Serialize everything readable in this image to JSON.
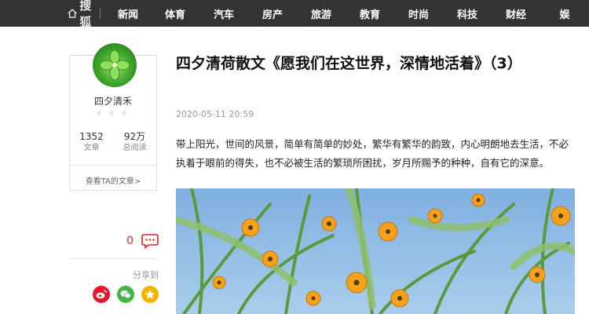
{
  "header": {
    "logo_text": "搜狐",
    "nav": [
      "新闻",
      "体育",
      "汽车",
      "房产",
      "旅游",
      "教育",
      "时尚",
      "科技",
      "财经",
      "娱"
    ]
  },
  "author": {
    "name": "四夕清禾",
    "articles_count": "1352",
    "articles_label": "文章",
    "views_count": "92万",
    "views_label": "总阅读",
    "link_text": "查看TA的文章>"
  },
  "sidebar": {
    "comment_count": "0",
    "share_label": "分享到"
  },
  "article": {
    "title": "四夕清荷散文《愿我们在这世界，深情地活着》（3）",
    "date": "2020-05-11 20:59",
    "paragraph": "带上阳光，世间的风景，简单有简单的妙处，繁华有繁华的韵致，内心明朗地去生活，不必执着于眼前的得失，也不必被生活的繁琐所困扰，岁月所赐予的种种，自有它的深意。"
  },
  "colors": {
    "topbar": "#333333",
    "comment_red": "#e02020",
    "weibo": "#e6162d",
    "wechat": "#44b549",
    "qzone": "#f5b400"
  }
}
